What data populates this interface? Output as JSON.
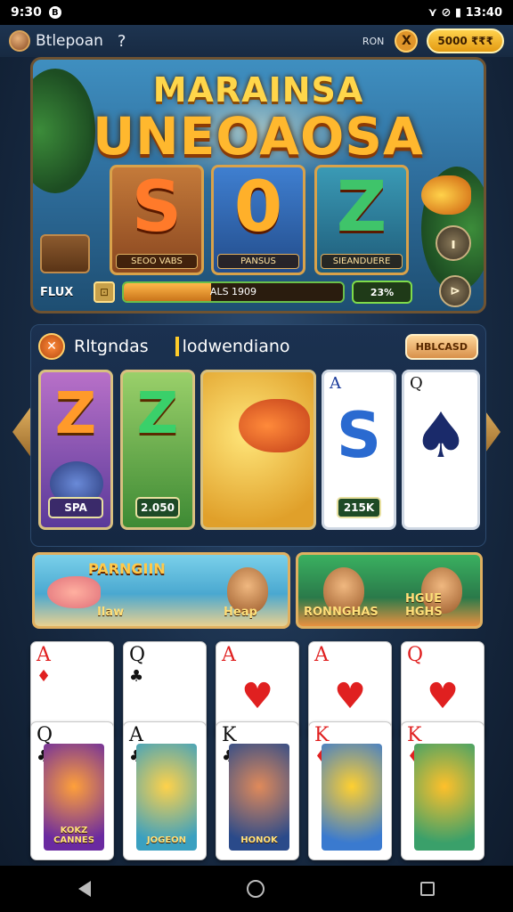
{
  "status": {
    "time": "9:30",
    "indicator": "B",
    "icons": "⋎ ⊘ ▮ 13:40"
  },
  "appbar": {
    "title": "Btlepoan",
    "help": "?",
    "bonus_label": "RON",
    "coin_symbol": "X",
    "balance": "5000 ₹₹₹"
  },
  "hero": {
    "title_line1": "MARAINSA",
    "title_line2": "UNEOAOSA",
    "reels": [
      {
        "symbol": "S",
        "label": "SEOO VABS"
      },
      {
        "symbol": "0",
        "label": "PANSUS"
      },
      {
        "symbol": "Z",
        "label": "SIEANDUERE"
      }
    ],
    "flux_label": "FLUX",
    "flux_icon": "⊡",
    "progress_text": "ALS 1909",
    "progress_value": 0.4,
    "badge_value": "23%",
    "top_button": "ı",
    "side_button": "⊳"
  },
  "rewards": {
    "icon": "✕",
    "title": "Rltgndas",
    "subtitle": "lodwendiano",
    "button": "HBLCASD",
    "tiles": [
      {
        "symbol": "Z",
        "tag": "SPA"
      },
      {
        "symbol": "Z",
        "tag": "2.050"
      },
      {
        "symbol": "",
        "tag": ""
      },
      {
        "corner": "A",
        "symbol": "S",
        "tag": "215K"
      },
      {
        "corner": "Q",
        "symbol": "♠",
        "tag": ""
      }
    ]
  },
  "promos": [
    {
      "title": "PARNGIIN",
      "label": "Ilaw",
      "label2": "Heap"
    },
    {
      "title": "",
      "label": "RONNGHAS",
      "label2": "HGUE HGHS"
    }
  ],
  "cards_top": [
    {
      "rank": "A",
      "suit": "♦",
      "color": "red"
    },
    {
      "rank": "Q",
      "suit": "♣",
      "color": "black"
    },
    {
      "rank": "A",
      "suit": "♥",
      "color": "red"
    },
    {
      "rank": "A",
      "suit": "♥",
      "color": "red"
    },
    {
      "rank": "Q",
      "suit": "♥",
      "color": "red"
    }
  ],
  "cards_bottom": [
    {
      "rank": "Q",
      "suit": "♣",
      "color": "black",
      "art_label": "KOKZ CANNES"
    },
    {
      "rank": "A",
      "suit": "♣",
      "color": "black",
      "art_label": "JOGEON"
    },
    {
      "rank": "K",
      "suit": "♣",
      "color": "black",
      "art_label": "HONOK"
    },
    {
      "rank": "K",
      "suit": "♦",
      "color": "red",
      "art_label": ""
    },
    {
      "rank": "K",
      "suit": "♦",
      "color": "red",
      "art_label": ""
    }
  ]
}
